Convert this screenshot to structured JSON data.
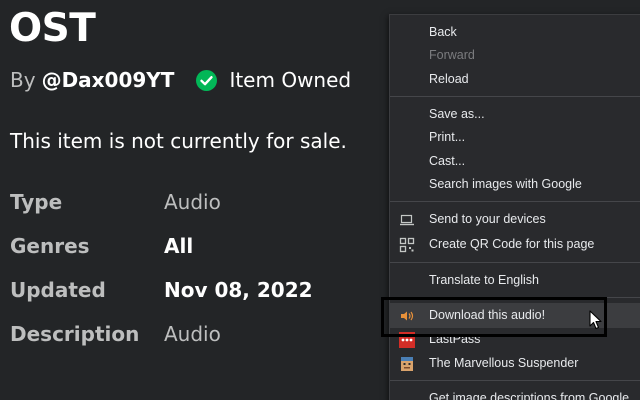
{
  "item": {
    "title": "OST",
    "by_prefix": "By",
    "creator": "@Dax009YT",
    "owned_label": "Item Owned",
    "sale_note": "This item is not currently for sale."
  },
  "details": [
    {
      "key": "Type",
      "value": "Audio"
    },
    {
      "key": "Genres",
      "value": "All"
    },
    {
      "key": "Updated",
      "value": "Nov 08, 2022"
    },
    {
      "key": "Description",
      "value": "Audio"
    }
  ],
  "context_menu": {
    "back": "Back",
    "forward": "Forward",
    "reload": "Reload",
    "save_as": "Save as...",
    "print": "Print...",
    "cast": "Cast...",
    "search_images": "Search images with Google",
    "send_devices": "Send to your devices",
    "qr_code": "Create QR Code for this page",
    "translate": "Translate to English",
    "download_audio": "Download this audio!",
    "lastpass": "LastPass",
    "suspender": "The Marvellous Suspender",
    "image_descriptions": "Get image descriptions from Google"
  },
  "colors": {
    "page_bg": "#232527",
    "menu_bg": "#292a2d",
    "owned_green": "#02b757",
    "lastpass_red": "#d32d27"
  },
  "icons": {
    "owned": "check-circle-icon",
    "send_devices": "laptop-icon",
    "qr_code": "qr-code-icon",
    "download_audio": "speaker-icon",
    "lastpass": "lastpass-icon",
    "suspender": "suspender-icon"
  }
}
